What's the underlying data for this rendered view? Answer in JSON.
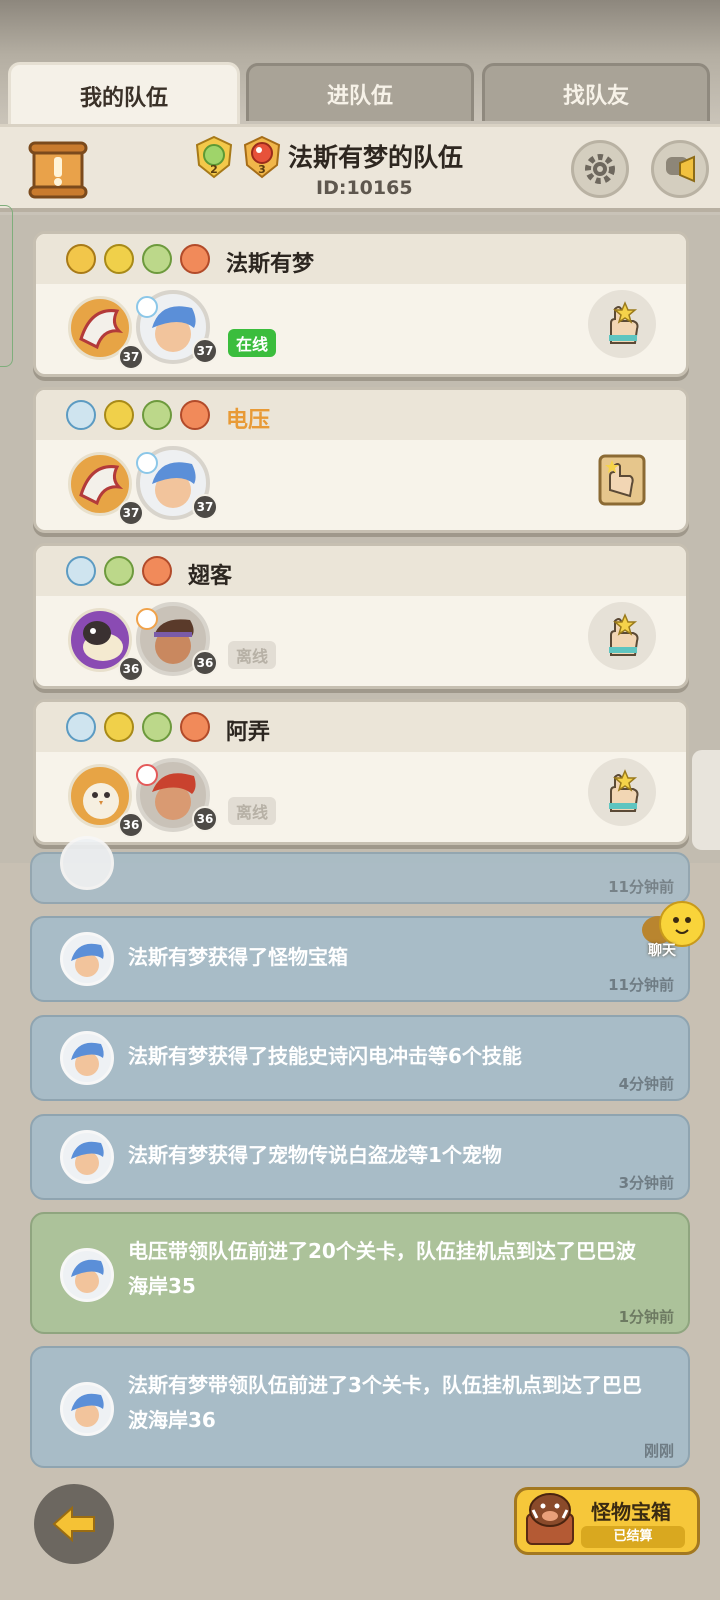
{
  "tabs": [
    {
      "label": "我的队伍",
      "active": true
    },
    {
      "label": "进队伍",
      "active": false
    },
    {
      "label": "找队友",
      "active": false
    }
  ],
  "header": {
    "team_title": "法斯有梦的队伍",
    "team_id": "ID:10165",
    "badge_levels": [
      "2",
      "3"
    ]
  },
  "members": [
    {
      "name": "法斯有梦",
      "name_color": "#2c2620",
      "pet_level": "37",
      "hero_level": "37",
      "status": "在线",
      "status_type": "online",
      "action_icon": "hand-star-icon"
    },
    {
      "name": "电压",
      "name_color": "#e89a36",
      "pet_level": "37",
      "hero_level": "37",
      "status": "",
      "status_type": "none",
      "action_icon": "card-swap-icon"
    },
    {
      "name": "翅客",
      "name_color": "#2c2620",
      "pet_level": "36",
      "hero_level": "36",
      "status": "离线",
      "status_type": "offline",
      "action_icon": "hand-star-icon"
    },
    {
      "name": "阿弄",
      "name_color": "#2c2620",
      "pet_level": "36",
      "hero_level": "36",
      "status": "离线",
      "status_type": "offline",
      "action_icon": "hand-star-icon"
    }
  ],
  "messages": [
    {
      "text": "",
      "time": "11分钟前",
      "color": "blue"
    },
    {
      "text": "法斯有梦获得了怪物宝箱",
      "time": "11分钟前",
      "color": "blue"
    },
    {
      "text": "法斯有梦获得了技能史诗闪电冲击等6个技能",
      "time": "4分钟前",
      "color": "blue"
    },
    {
      "text": "法斯有梦获得了宠物传说白盗龙等1个宠物",
      "time": "3分钟前",
      "color": "blue"
    },
    {
      "text": "电压带领队伍前进了20个关卡，队伍挂机点到达了巴巴波海岸35",
      "time": "1分钟前",
      "color": "green"
    },
    {
      "text": "法斯有梦带领队伍前进了3个关卡，队伍挂机点到达了巴巴波海岸36",
      "time": "刚刚",
      "color": "blue"
    }
  ],
  "chat_label": "聊天",
  "chest": {
    "title": "怪物宝箱",
    "status": "已结算"
  }
}
